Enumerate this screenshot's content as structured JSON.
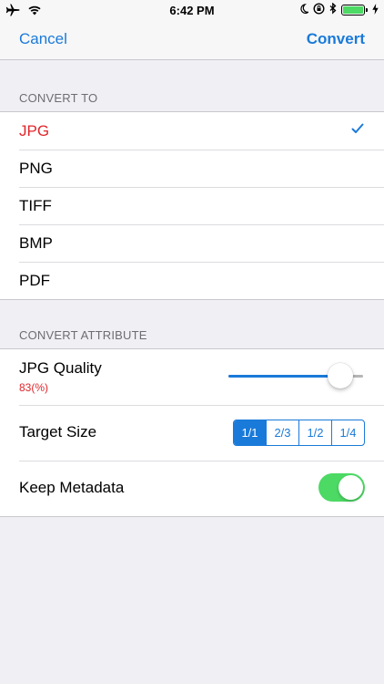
{
  "status_bar": {
    "time": "6:42 PM",
    "left_icons": [
      "airplane-icon",
      "wifi-icon"
    ],
    "right_icons": [
      "moon-icon",
      "orientation-lock-icon",
      "bluetooth-icon",
      "battery-icon",
      "charging-icon"
    ],
    "battery_level": 1.0
  },
  "nav": {
    "cancel_label": "Cancel",
    "convert_label": "Convert"
  },
  "convert_to": {
    "header": "CONVERT TO",
    "formats": [
      "JPG",
      "PNG",
      "TIFF",
      "BMP",
      "PDF"
    ],
    "selected": "JPG"
  },
  "convert_attribute": {
    "header": "CONVERT ATTRIBUTE",
    "quality": {
      "label": "JPG Quality",
      "value_text": "83(%)",
      "value": 83
    },
    "target_size": {
      "label": "Target Size",
      "options": [
        "1/1",
        "2/3",
        "1/2",
        "1/4"
      ],
      "selected": "1/1"
    },
    "metadata": {
      "label": "Keep Metadata",
      "on": true
    }
  },
  "colors": {
    "accent": "#1a7ad9",
    "selected_text": "#e0262b",
    "toggle_on": "#4cd964",
    "background": "#efeff4"
  }
}
